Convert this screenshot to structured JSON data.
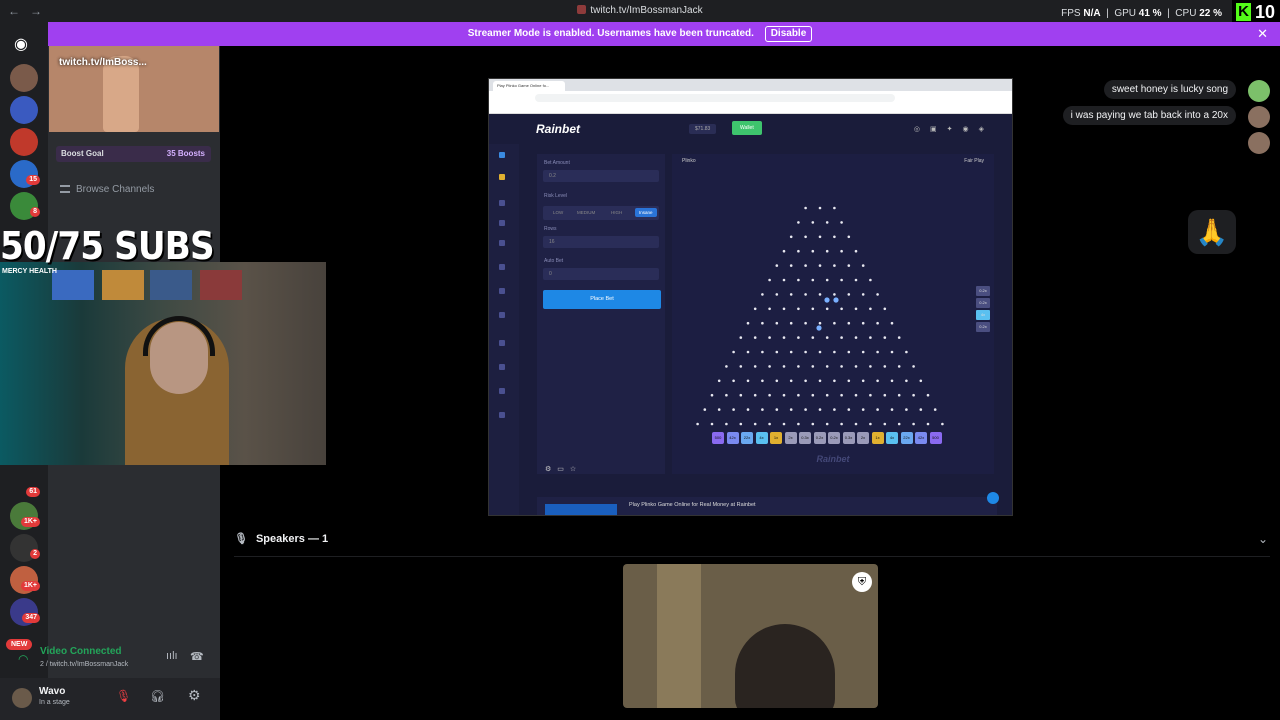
{
  "titlebar": {
    "title": "twitch.tv/ImBossmanJack",
    "fps_label": "FPS",
    "fps_value": "N/A",
    "gpu_label": "GPU",
    "gpu_value": "41 %",
    "cpu_label": "CPU",
    "cpu_value": "22 %",
    "kick_count": "10"
  },
  "banner": {
    "text": "Streamer Mode is enabled. Usernames have been truncated.",
    "button": "Disable"
  },
  "rail": {
    "badges": [
      "15",
      "8",
      "61",
      "1K+",
      "2",
      "1K+",
      "347"
    ],
    "new_label": "NEW"
  },
  "sidebar": {
    "stream_title": "twitch.tv/ImBoss...",
    "boost_goal": "Boost Goal",
    "boost_count": "35 Boosts",
    "browse": "Browse Channels",
    "voice_status": "Video Connected",
    "voice_channel": "2 / twitch.tv/ImBossmanJack",
    "user_name": "Wavo",
    "user_status": "In a stage"
  },
  "overlay": {
    "subs_goal": "50/75 SUBS",
    "sponsor": "MERCY HEALTH"
  },
  "rainbet": {
    "brand": "Rainbet",
    "wallet_btn": "Wallet",
    "balance": "$71.83",
    "bet_amount_label": "Bet Amount",
    "bet_amount_value": "0.2",
    "risk_label": "Risk Level",
    "risk_options": [
      "LOW",
      "MEDIUM",
      "HIGH",
      "Insane"
    ],
    "rows_label": "Rows",
    "rows_value": "16",
    "autobet_label": "Auto Bet",
    "autobet_value": "0",
    "place_bet": "Place Bet",
    "game_title": "Plinko",
    "fair_play": "Fair Play",
    "multipliers": [
      "500",
      "42x",
      "22x",
      "4x",
      "1x",
      "2x",
      "0.3x",
      "0.2x",
      "0.2x",
      "0.3x",
      "2x",
      "1x",
      "4x",
      "22x",
      "42x",
      "500"
    ],
    "history": [
      "0.2x",
      "0.2x",
      "4x",
      "0.2x"
    ],
    "footer_text": "Play Plinko Game Online for Real Money at Rainbet",
    "tab_title": "Play Plinko Game Online fo..."
  },
  "chat": {
    "messages": [
      "sweet honey is lucky song",
      "i was paying we tab back into a 20x"
    ],
    "emoji": "🙏"
  },
  "stage": {
    "speakers_label": "Speakers — 1"
  },
  "colors": {
    "banner": "#a040f0",
    "discord_bg": "#000000",
    "rainbet_bg": "#1a1c3a",
    "place_bet": "#1e88e5",
    "voice_green": "#23a55a"
  }
}
